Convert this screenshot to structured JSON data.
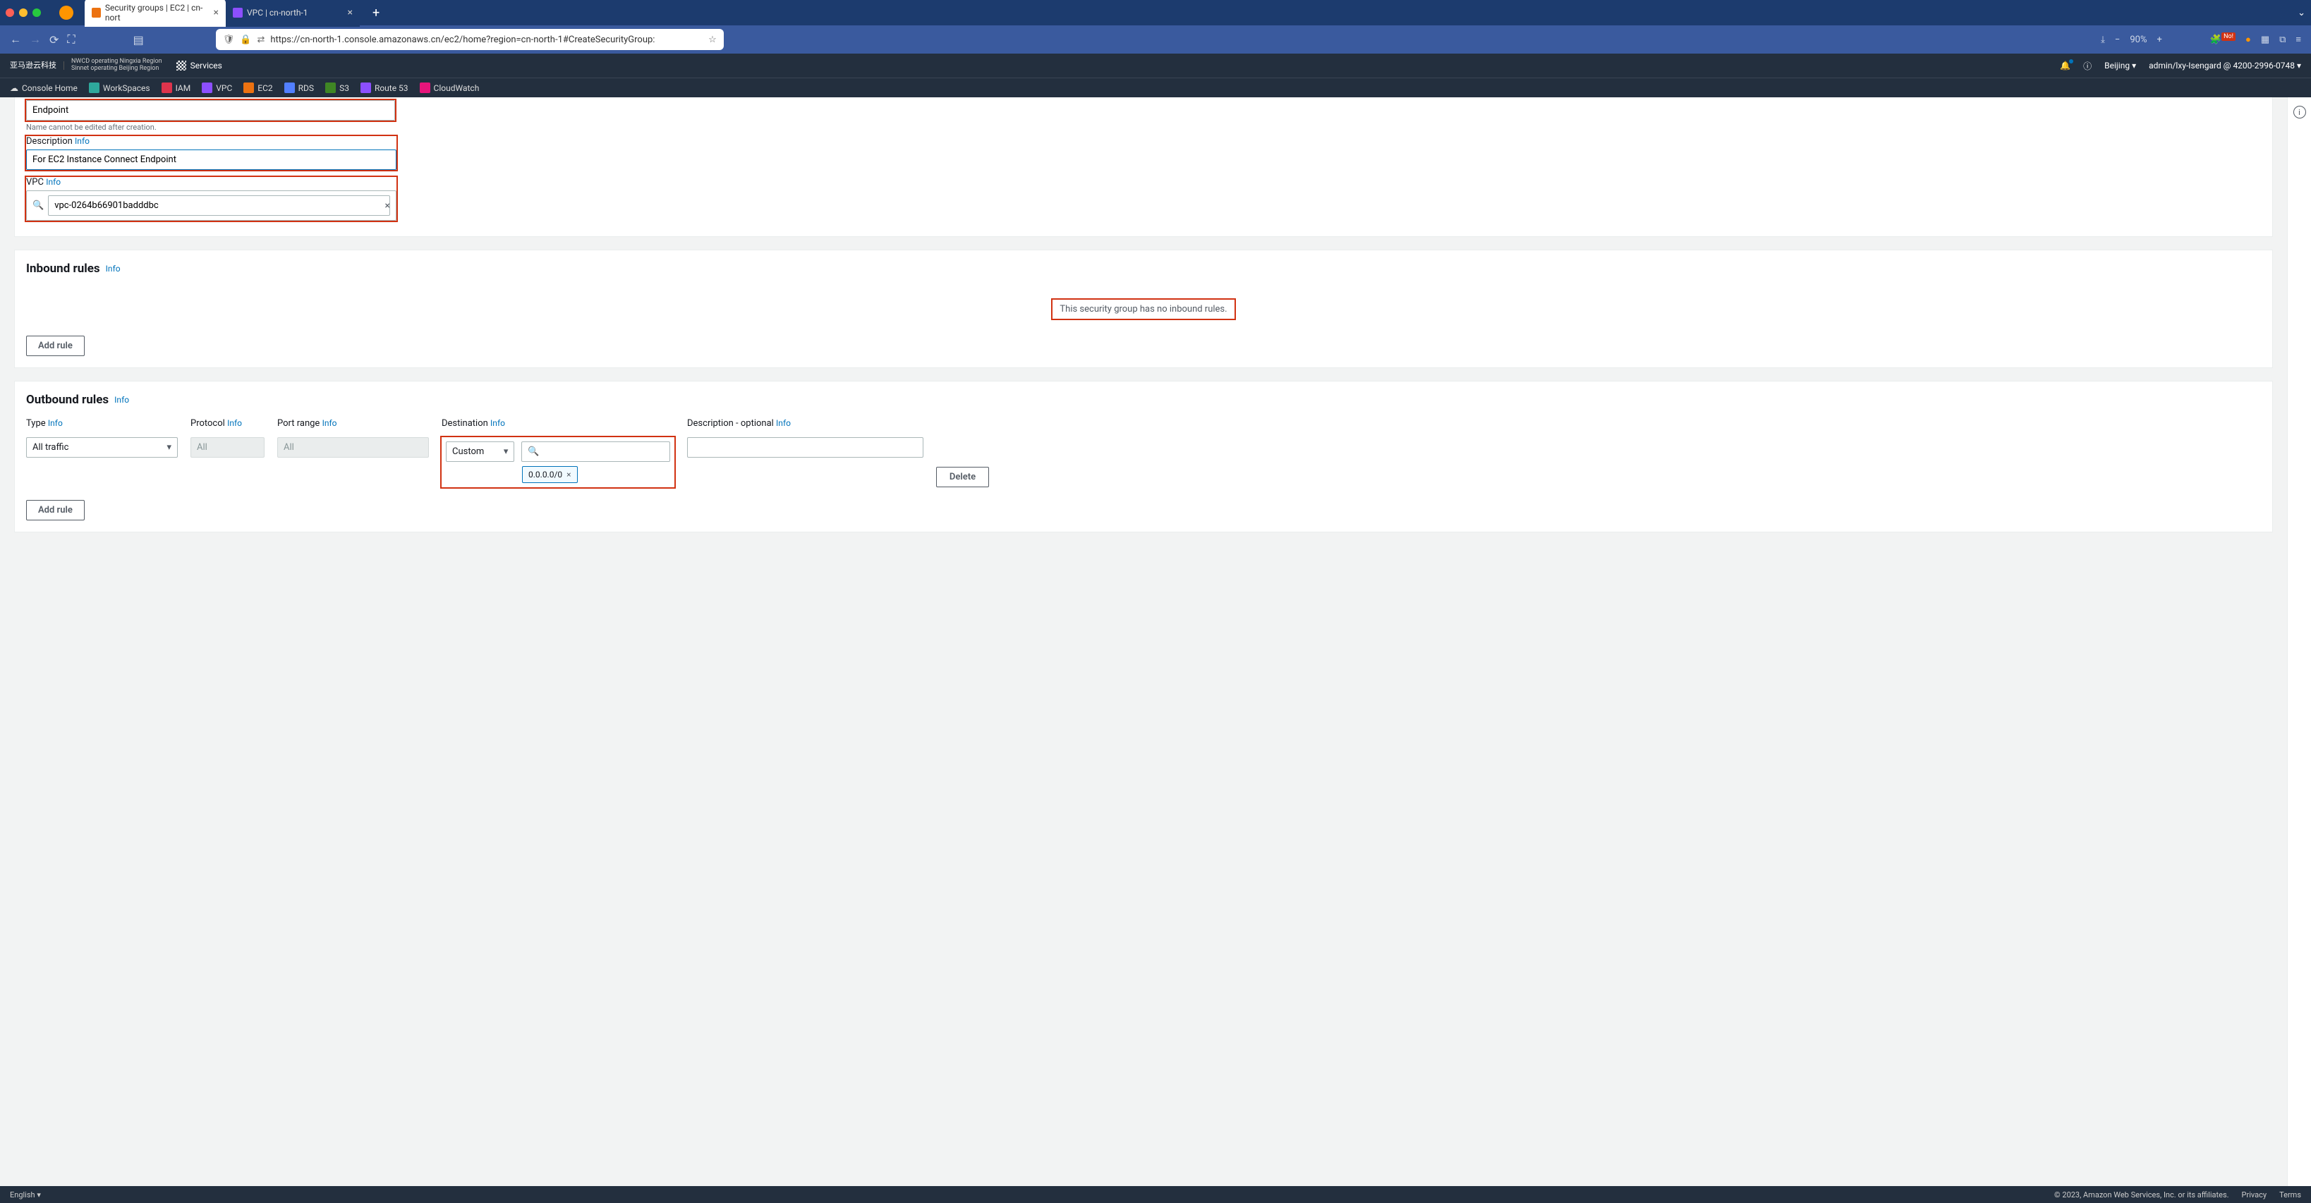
{
  "browser": {
    "tabs": [
      {
        "title": "Security groups | EC2 | cn-nort",
        "active": true,
        "icon": "ec2"
      },
      {
        "title": "VPC | cn-north-1",
        "active": false,
        "icon": "vpc"
      }
    ],
    "url": "https://cn-north-1.console.amazonaws.cn/ec2/home?region=cn-north-1#CreateSecurityGroup:",
    "zoom": "90%"
  },
  "aws_header": {
    "logo_cn": "亚马逊云科技",
    "nwcd": "NWCD operating Ningxia Region",
    "sinnet": "Sinnet operating Beijing Region",
    "services": "Services",
    "region": "Beijing",
    "account": "admin/lxy-Isengard @ 4200-2996-0748"
  },
  "aws_nav": [
    "Console Home",
    "WorkSpaces",
    "IAM",
    "VPC",
    "EC2",
    "RDS",
    "S3",
    "Route 53",
    "CloudWatch"
  ],
  "form": {
    "name_value": "Endpoint",
    "name_hint": "Name cannot be edited after creation.",
    "desc_label": "Description",
    "desc_value": "For EC2 Instance Connect Endpoint",
    "vpc_label": "VPC",
    "vpc_value": "vpc-0264b66901badddbc"
  },
  "inbound": {
    "title": "Inbound rules",
    "empty": "This security group has no inbound rules.",
    "add": "Add rule"
  },
  "outbound": {
    "title": "Outbound rules",
    "cols": {
      "type": "Type",
      "protocol": "Protocol",
      "port": "Port range",
      "dest": "Destination",
      "desc": "Description - optional"
    },
    "row": {
      "type": "All traffic",
      "protocol": "All",
      "port": "All",
      "dest_mode": "Custom",
      "cidr": "0.0.0.0/0"
    },
    "delete": "Delete",
    "add": "Add rule"
  },
  "info": "Info",
  "footer": {
    "lang": "English",
    "copy": "© 2023, Amazon Web Services, Inc. or its affiliates.",
    "privacy": "Privacy",
    "terms": "Terms"
  }
}
